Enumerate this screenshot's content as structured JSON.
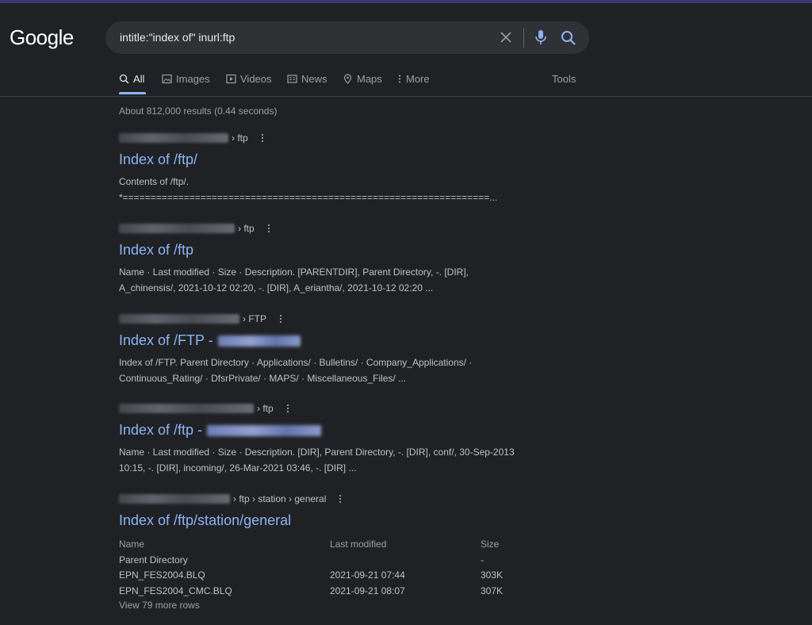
{
  "logo": "Google",
  "search": {
    "query": "intitle:\"index of\" inurl:ftp"
  },
  "tabs": [
    {
      "label": "All",
      "icon": "search-icon"
    },
    {
      "label": "Images",
      "icon": "image-icon"
    },
    {
      "label": "Videos",
      "icon": "video-icon"
    },
    {
      "label": "News",
      "icon": "news-icon"
    },
    {
      "label": "Maps",
      "icon": "map-pin-icon"
    },
    {
      "label": "More",
      "icon": "more-vertical-icon"
    }
  ],
  "tools_label": "Tools",
  "stats": "About 812,000 results (0.44 seconds)",
  "results": [
    {
      "breadcrumb": "› ftp",
      "title": "Index of /ftp/",
      "snippet": [
        "Contents of /ftp/.",
        "*==================================================================..."
      ]
    },
    {
      "breadcrumb": "› ftp",
      "title": "Index of /ftp",
      "snippet": [
        "Name · Last modified · Size · Description. [PARENTDIR], Parent Directory, -. [DIR],",
        "A_chinensis/, 2021-10-12 02:20, -. [DIR], A_eriantha/, 2021-10-12 02:20 ..."
      ]
    },
    {
      "breadcrumb": "› FTP",
      "title": "Index of /FTP -",
      "snippet": [
        "Index of /FTP. Parent Directory · Applications/ · Bulletins/ · Company_Applications/ ·",
        "Continuous_Rating/ · DfsrPrivate/ · MAPS/ · Miscellaneous_Files/ ..."
      ]
    },
    {
      "breadcrumb": "› ftp",
      "title": "Index of /ftp -",
      "snippet": [
        "Name · Last modified · Size · Description. [DIR], Parent Directory, -. [DIR], conf/, 30-Sep-2013",
        "10:15, -. [DIR], incoming/, 26-Mar-2021 03:46, -. [DIR] ..."
      ]
    },
    {
      "breadcrumb": "› ftp › station › general",
      "title": "Index of /ftp/station/general",
      "table": {
        "headers": [
          "Name",
          "Last modified",
          "Size"
        ],
        "rows": [
          [
            "Parent Directory",
            "",
            "-"
          ],
          [
            "EPN_FES2004.BLQ",
            "2021-09-21 07:44",
            "303K"
          ],
          [
            "EPN_FES2004_CMC.BLQ",
            "2021-09-21 08:07",
            "307K"
          ]
        ],
        "more": "View 79 more rows"
      }
    }
  ]
}
